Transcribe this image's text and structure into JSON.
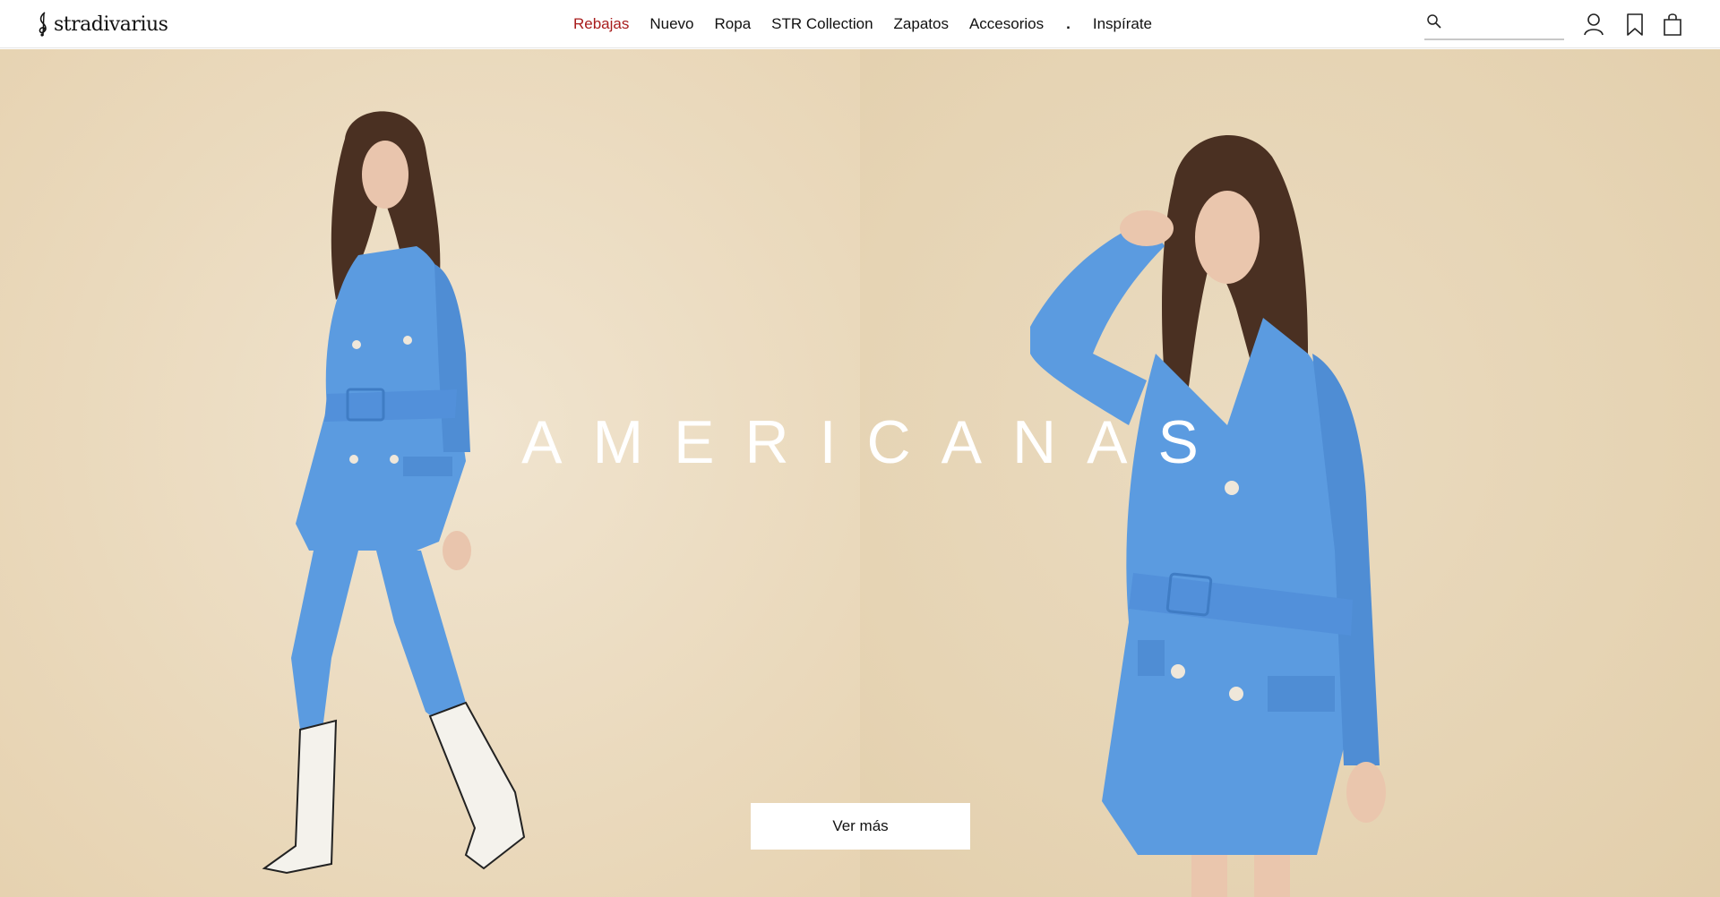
{
  "brand": {
    "logo_text": "stradivarius"
  },
  "nav": {
    "items": [
      {
        "label": "Rebajas",
        "active": true
      },
      {
        "label": "Nuevo"
      },
      {
        "label": "Ropa"
      },
      {
        "label": "STR Collection"
      },
      {
        "label": "Zapatos"
      },
      {
        "label": "Accesorios"
      },
      {
        "label": "."
      },
      {
        "label": "Inspírate"
      }
    ]
  },
  "search": {
    "value": "",
    "placeholder": ""
  },
  "icons": {
    "search": "search-icon",
    "user": "user-icon",
    "wishlist": "bookmark-icon",
    "bag": "shopping-bag-icon"
  },
  "hero": {
    "title": "AMERICANAS",
    "cta_label": "Ver más"
  },
  "colors": {
    "accent": "#a81c1c",
    "garment": "#5b9be0",
    "background": "#ecdcbf"
  }
}
